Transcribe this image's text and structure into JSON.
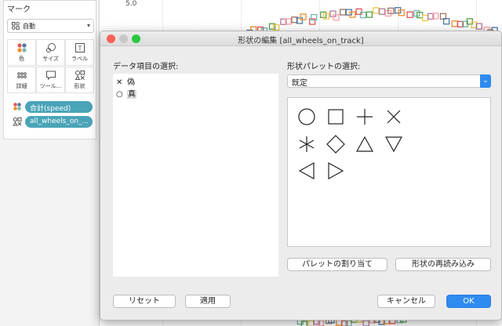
{
  "background": {
    "marks_card": {
      "title": "マーク",
      "mark_type": "自動",
      "buttons": [
        {
          "label": "色",
          "icon": "color-dots-icon"
        },
        {
          "label": "サイズ",
          "icon": "size-icon"
        },
        {
          "label": "ラベル",
          "icon": "label-icon"
        },
        {
          "label": "詳細",
          "icon": "detail-icon"
        },
        {
          "label": "ツール...",
          "icon": "tooltip-icon"
        },
        {
          "label": "形状",
          "icon": "shape-icon"
        }
      ],
      "pills": [
        {
          "label": "合計(speed)",
          "icon": "color-dots-icon"
        },
        {
          "label": "all_wheels_on_...",
          "icon": "shape-icon"
        }
      ]
    },
    "chart": {
      "y_tick": "5.0"
    }
  },
  "dialog": {
    "title": "形状の編集 [all_wheels_on_track]",
    "data_items_label": "データ項目の選択:",
    "data_items": [
      {
        "glyph": "✕",
        "label": "偽"
      },
      {
        "glyph": "○",
        "label": "真"
      }
    ],
    "palette_label": "形状パレットの選択:",
    "palette_value": "既定",
    "shapes": [
      "circle",
      "square",
      "plus",
      "cross",
      "asterisk",
      "diamond",
      "triangle-up",
      "triangle-down",
      "triangle-left",
      "triangle-right"
    ],
    "assign_palette_button": "パレットの割り当て",
    "reload_shapes_button": "形状の再読み込み",
    "reset_button": "リセット",
    "apply_button": "適用",
    "cancel_button": "キャンセル",
    "ok_button": "OK"
  },
  "colors": {
    "accent": "#2f8bf0",
    "pill": "#4aa4b8",
    "close": "#fe5f57",
    "minimize": "#c8c8c8",
    "zoom": "#28c840"
  }
}
